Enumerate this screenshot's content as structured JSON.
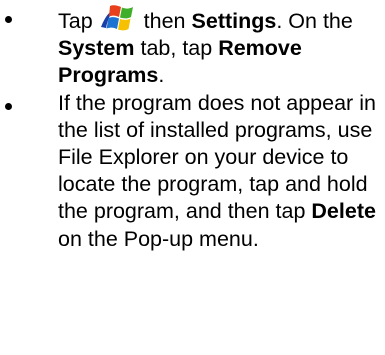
{
  "steps": [
    {
      "t1": "Tap",
      "t2": "then",
      "b1": "Settings",
      "t3": ". On the",
      "b2": "System",
      "t4": "tab, tap",
      "b3": "Remove Programs",
      "t5": ".",
      "icon": "windows-start-icon"
    },
    {
      "t1": "If the program does not appear in the list of installed programs, use File Explorer on your device to locate the program, tap and hold the program, and then tap",
      "b1": "Delete",
      "t2": "on the Pop-up menu."
    }
  ],
  "colors": {
    "text": "#000000",
    "background": "#ffffff",
    "logo_red": "#e8401c",
    "logo_green": "#3fae2a",
    "logo_blue": "#1e73d2",
    "logo_yellow": "#f5c100"
  }
}
